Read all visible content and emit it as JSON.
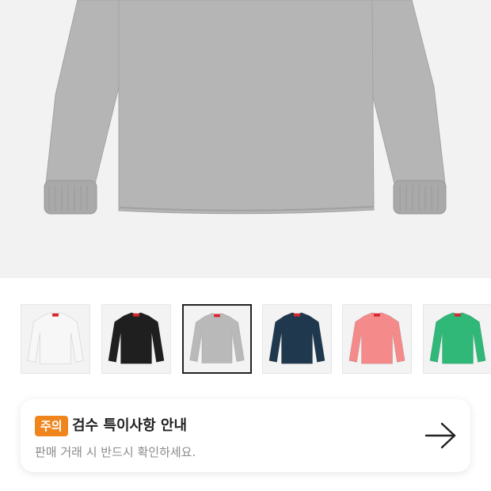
{
  "hero": {
    "image": "gray-long-sleeve-tshirt",
    "background": "#f2f2f2",
    "shirt_color": "#b4b4b4"
  },
  "thumbnails": [
    {
      "color_name": "white",
      "shirt_color": "#f7f7f7",
      "selected": false
    },
    {
      "color_name": "black",
      "shirt_color": "#1f1f1f",
      "selected": false
    },
    {
      "color_name": "heather-grey",
      "shirt_color": "#b9b9b9",
      "selected": true
    },
    {
      "color_name": "navy",
      "shirt_color": "#20384d",
      "selected": false
    },
    {
      "color_name": "pink",
      "shirt_color": "#f48a8a",
      "selected": false
    },
    {
      "color_name": "green",
      "shirt_color": "#2fb878",
      "selected": false
    }
  ],
  "notice": {
    "badge": "주의",
    "title": "검수 특이사항 안내",
    "subtitle": "판매 거래 시 반드시 확인하세요.",
    "badge_color": "#f0851d",
    "icon": "arrow-right-icon"
  }
}
